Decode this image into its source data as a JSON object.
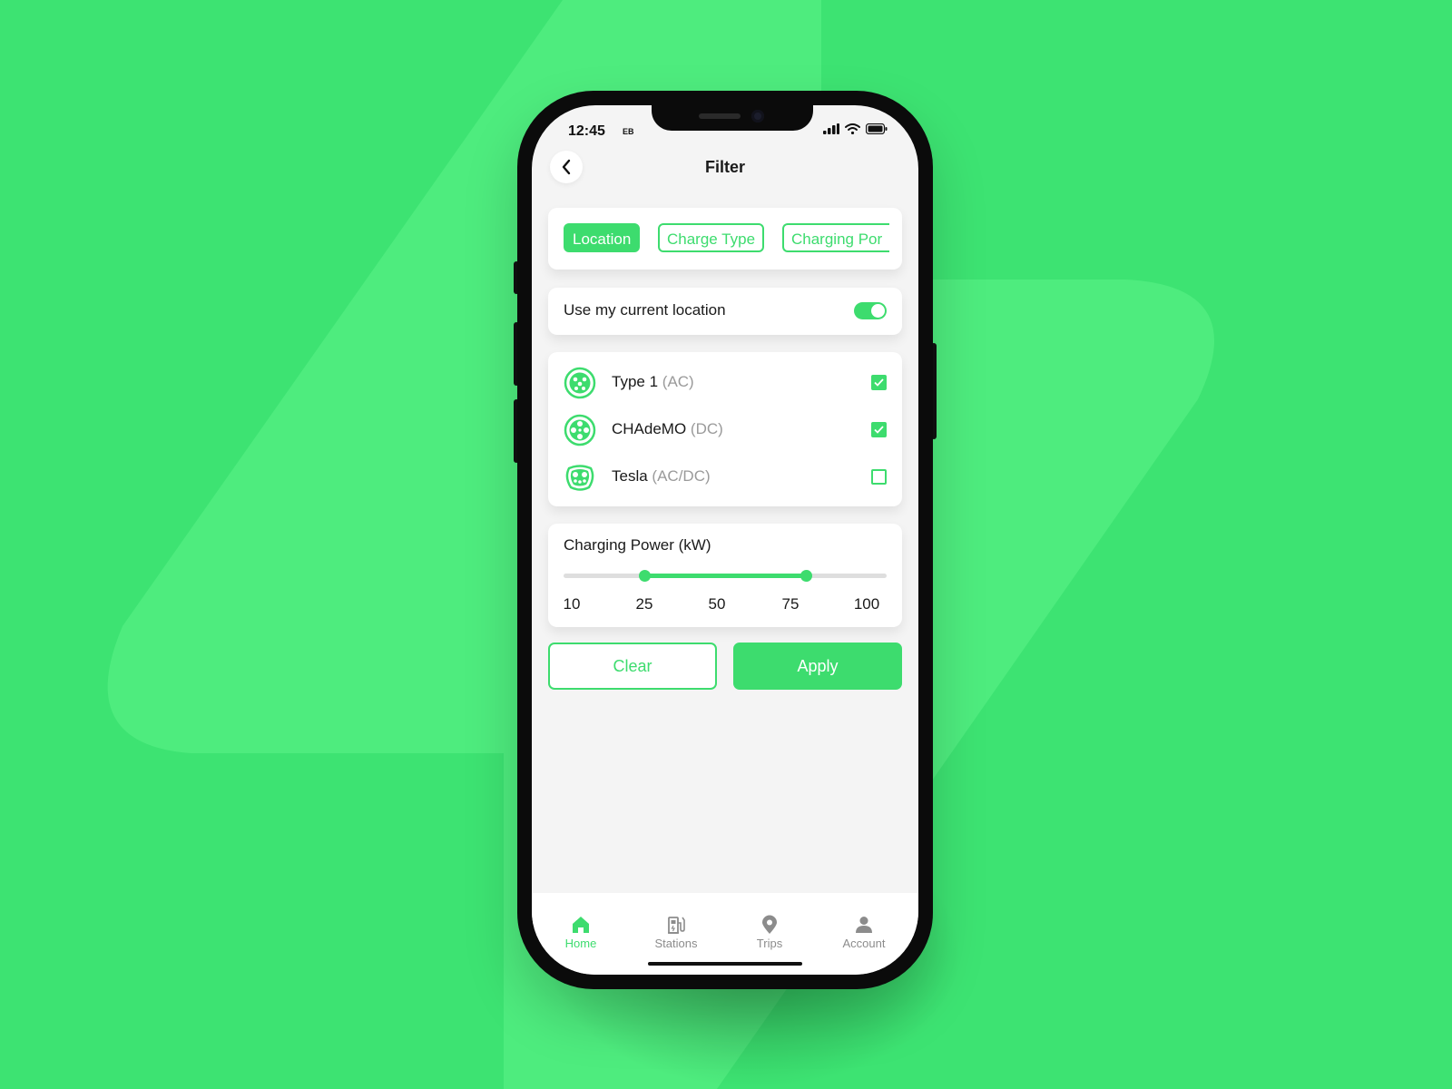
{
  "colors": {
    "accent": "#3ddc6e",
    "background": "#3de372",
    "shape": "#4eec7e",
    "muted": "#9a9a9a"
  },
  "status_bar": {
    "time": "12:45",
    "carrier": "EB",
    "icons": [
      "signal-icon",
      "wifi-icon",
      "battery-icon"
    ]
  },
  "header": {
    "title": "Filter",
    "back_icon": "chevron-left-icon"
  },
  "filter_tabs": [
    {
      "label": "Location",
      "active": true
    },
    {
      "label": "Charge Type",
      "active": false
    },
    {
      "label": "Charging Por",
      "active": false
    }
  ],
  "location": {
    "label": "Use my current location",
    "enabled": true
  },
  "plug_types": [
    {
      "name": "Type 1",
      "kind": "(AC)",
      "checked": true,
      "icon": "type1-plug-icon"
    },
    {
      "name": "CHAdeMO",
      "kind": "(DC)",
      "checked": true,
      "icon": "chademo-plug-icon"
    },
    {
      "name": "Tesla",
      "kind": "(AC/DC)",
      "checked": false,
      "icon": "tesla-plug-icon"
    }
  ],
  "charging_power": {
    "title": "Charging Power (kW)",
    "ticks": [
      "10",
      "25",
      "50",
      "75",
      "100"
    ],
    "range_low": 25,
    "range_high": 75
  },
  "actions": {
    "clear_label": "Clear",
    "apply_label": "Apply"
  },
  "tab_bar": [
    {
      "label": "Home",
      "icon": "home-icon",
      "active": true
    },
    {
      "label": "Stations",
      "icon": "charging-station-icon",
      "active": false
    },
    {
      "label": "Trips",
      "icon": "map-pin-icon",
      "active": false
    },
    {
      "label": "Account",
      "icon": "user-icon",
      "active": false
    }
  ]
}
